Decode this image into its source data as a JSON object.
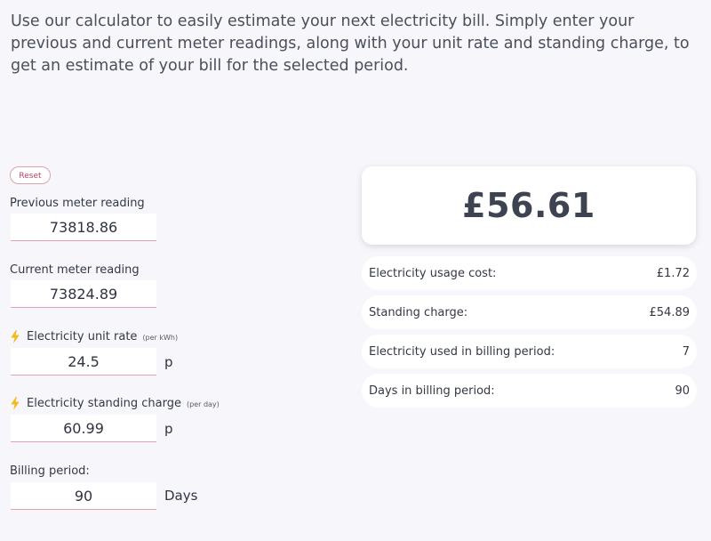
{
  "intro": "Use our calculator to easily estimate your next electricity bill. Simply enter your previous and current meter readings, along with your unit rate and standing charge, to get an estimate of your bill for the selected period.",
  "reset_label": "Reset",
  "fields": {
    "previous": {
      "label": "Previous meter reading",
      "value": "73818.86"
    },
    "current": {
      "label": "Current meter reading",
      "value": "73824.89"
    },
    "unit_rate": {
      "label": "Electricity unit rate",
      "sublabel": "(per kWh)",
      "value": "24.5",
      "unit": "p",
      "icon": "lightning-bolt-icon"
    },
    "standing": {
      "label": "Electricity standing charge",
      "sublabel": "(per day)",
      "value": "60.99",
      "unit": "p",
      "icon": "lightning-bolt-icon"
    },
    "billing": {
      "label": "Billing period:",
      "value": "90",
      "unit": "Days"
    }
  },
  "results": {
    "total": "£56.61",
    "rows": [
      {
        "label": "Electricity usage cost:",
        "value": "£1.72"
      },
      {
        "label": "Standing charge:",
        "value": "£54.89"
      },
      {
        "label": "Electricity used in billing period:",
        "value": "7"
      },
      {
        "label": "Days in billing period:",
        "value": "90"
      }
    ]
  },
  "colors": {
    "background": "#f7f7fb",
    "accent_pink": "#e3a3b2",
    "bolt_yellow": "#f5b81c"
  }
}
